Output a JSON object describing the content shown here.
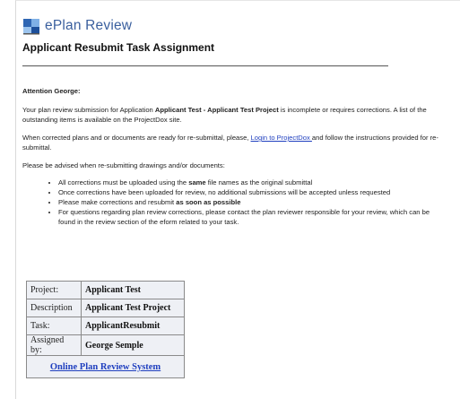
{
  "header": {
    "logo_text": "ePlan Review",
    "subtitle": "Applicant Resubmit Task Assignment"
  },
  "message": {
    "attention": "Attention George:",
    "para1_a": "Your plan review submission for Application ",
    "para1_bold": "Applicant Test - Applicant Test Project",
    "para1_b": " is incomplete or requires corrections. A list of the outstanding items is available on the ProjectDox site.",
    "para2_a": "When corrected plans and or documents are ready for re-submittal, please, ",
    "para2_link": "Login to ProjectDox ",
    "para2_b": "and follow the instructions provided for re-submittal.",
    "para3": "Please be advised when re-submitting drawings and/or documents:",
    "bullet1_a": "All corrections must be uploaded using the ",
    "bullet1_bold": "same",
    "bullet1_b": " file names as the original submittal",
    "bullet2": "Once corrections have been uploaded for review, no additional submissions will be accepted unless requested",
    "bullet3_a": "Please make corrections and resubmit ",
    "bullet3_bold": "as soon as possible",
    "bullet4": "For questions regarding plan review corrections, please contact the plan reviewer responsible for your review, which can be found in the review section of the eform related to your task."
  },
  "table": {
    "rows": [
      {
        "label": "Project:",
        "value": "Applicant Test"
      },
      {
        "label": "Description",
        "value": "Applicant Test Project"
      },
      {
        "label": "Task:",
        "value": "ApplicantResubmit"
      },
      {
        "label": "Assigned by:",
        "value": "George Semple"
      }
    ],
    "link": "Online Plan Review System"
  },
  "colors": {
    "accent": "#3a5f9e",
    "link": "#1f3fbf",
    "table_bg": "#eef0f5"
  }
}
